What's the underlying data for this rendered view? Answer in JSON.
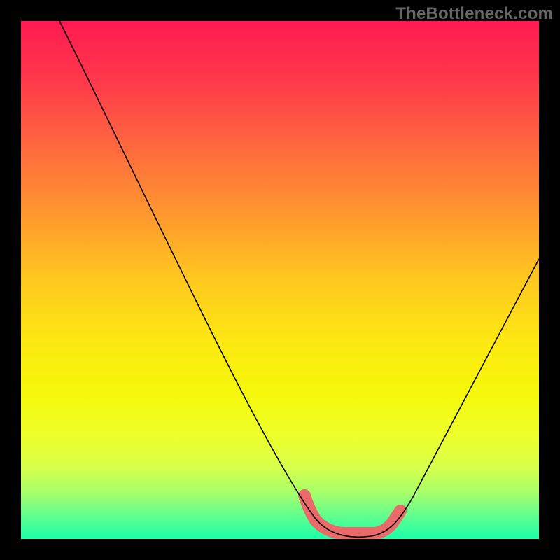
{
  "watermark": "TheBottleneck.com",
  "chart_data": {
    "type": "line",
    "title": "",
    "xlabel": "",
    "ylabel": "",
    "xlim": [
      0,
      100
    ],
    "ylim": [
      0,
      100
    ],
    "grid": false,
    "legend": false,
    "series": [
      {
        "name": "bottleneck-curve",
        "x": [
          0,
          5,
          10,
          15,
          20,
          25,
          30,
          35,
          40,
          45,
          50,
          55,
          58,
          60,
          62,
          65,
          68,
          70,
          72,
          75,
          80,
          85,
          90,
          95,
          100
        ],
        "y": [
          100,
          92,
          84,
          76,
          68,
          60,
          52,
          44,
          36,
          28,
          20,
          12,
          7,
          4,
          2,
          1,
          1,
          2,
          4,
          8,
          16,
          25,
          34,
          44,
          54
        ]
      }
    ],
    "highlight_band": {
      "name": "optimal-region",
      "x_start": 55,
      "x_end": 73,
      "color": "#ea6a6a"
    },
    "background_gradient": {
      "top": "#ff1a52",
      "bottom": "#1affaa"
    }
  }
}
